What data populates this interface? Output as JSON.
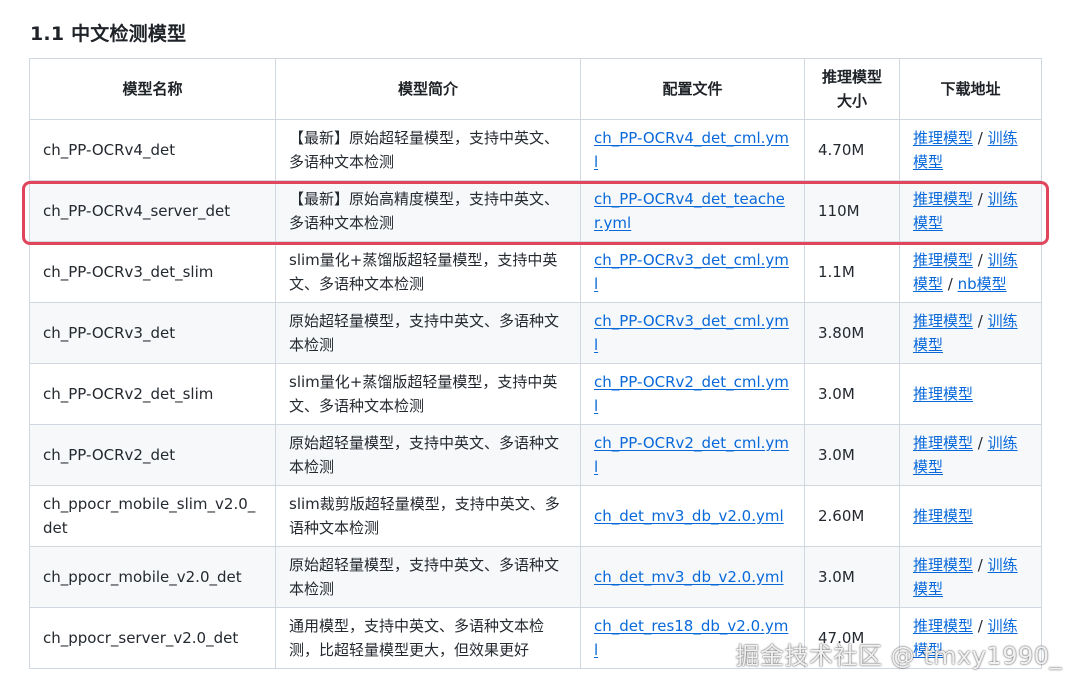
{
  "section_title": "1.1 中文检测模型",
  "headers": [
    "模型名称",
    "模型简介",
    "配置文件",
    "推理模型大小",
    "下载地址"
  ],
  "rows": [
    {
      "name": "ch_PP-OCRv4_det",
      "desc": "【最新】原始超轻量模型，支持中英文、多语种文本检测",
      "config": "ch_PP-OCRv4_det_cml.yml",
      "size": "4.70M",
      "downloads": [
        "推理模型",
        "训练模型"
      ]
    },
    {
      "name": "ch_PP-OCRv4_server_det",
      "desc": "【最新】原始高精度模型，支持中英文、多语种文本检测",
      "config": "ch_PP-OCRv4_det_teacher.yml",
      "size": "110M",
      "downloads": [
        "推理模型",
        "训练模型"
      ]
    },
    {
      "name": "ch_PP-OCRv3_det_slim",
      "desc": "slim量化+蒸馏版超轻量模型，支持中英文、多语种文本检测",
      "config": "ch_PP-OCRv3_det_cml.yml",
      "size": "1.1M",
      "downloads": [
        "推理模型",
        "训练模型",
        "nb模型"
      ]
    },
    {
      "name": "ch_PP-OCRv3_det",
      "desc": "原始超轻量模型，支持中英文、多语种文本检测",
      "config": "ch_PP-OCRv3_det_cml.yml",
      "size": "3.80M",
      "downloads": [
        "推理模型",
        "训练模型"
      ]
    },
    {
      "name": "ch_PP-OCRv2_det_slim",
      "desc": "slim量化+蒸馏版超轻量模型，支持中英文、多语种文本检测",
      "config": "ch_PP-OCRv2_det_cml.yml",
      "size": "3.0M",
      "downloads": [
        "推理模型"
      ]
    },
    {
      "name": "ch_PP-OCRv2_det",
      "desc": "原始超轻量模型，支持中英文、多语种文本检测",
      "config": "ch_PP-OCRv2_det_cml.yml",
      "size": "3.0M",
      "downloads": [
        "推理模型",
        "训练模型"
      ]
    },
    {
      "name": "ch_ppocr_mobile_slim_v2.0_det",
      "desc": "slim裁剪版超轻量模型，支持中英文、多语种文本检测",
      "config": "ch_det_mv3_db_v2.0.yml",
      "size": "2.60M",
      "downloads": [
        "推理模型"
      ]
    },
    {
      "name": "ch_ppocr_mobile_v2.0_det",
      "desc": "原始超轻量模型，支持中英文、多语种文本检测",
      "config": "ch_det_mv3_db_v2.0.yml",
      "size": "3.0M",
      "downloads": [
        "推理模型",
        "训练模型"
      ]
    },
    {
      "name": "ch_ppocr_server_v2.0_det",
      "desc": "通用模型，支持中英文、多语种文本检测，比超轻量模型更大，但效果更好",
      "config": "ch_det_res18_db_v2.0.yml",
      "size": "47.0M",
      "downloads": [
        "推理模型",
        "训练模型"
      ]
    }
  ],
  "download_separator": " / ",
  "watermark": "掘金技术社区 @ tmxy1990_",
  "colors": {
    "link": "#0969da",
    "highlight_border": "#e0455c",
    "row_stripe": "#f6f8fa",
    "border": "#d0d7de"
  }
}
